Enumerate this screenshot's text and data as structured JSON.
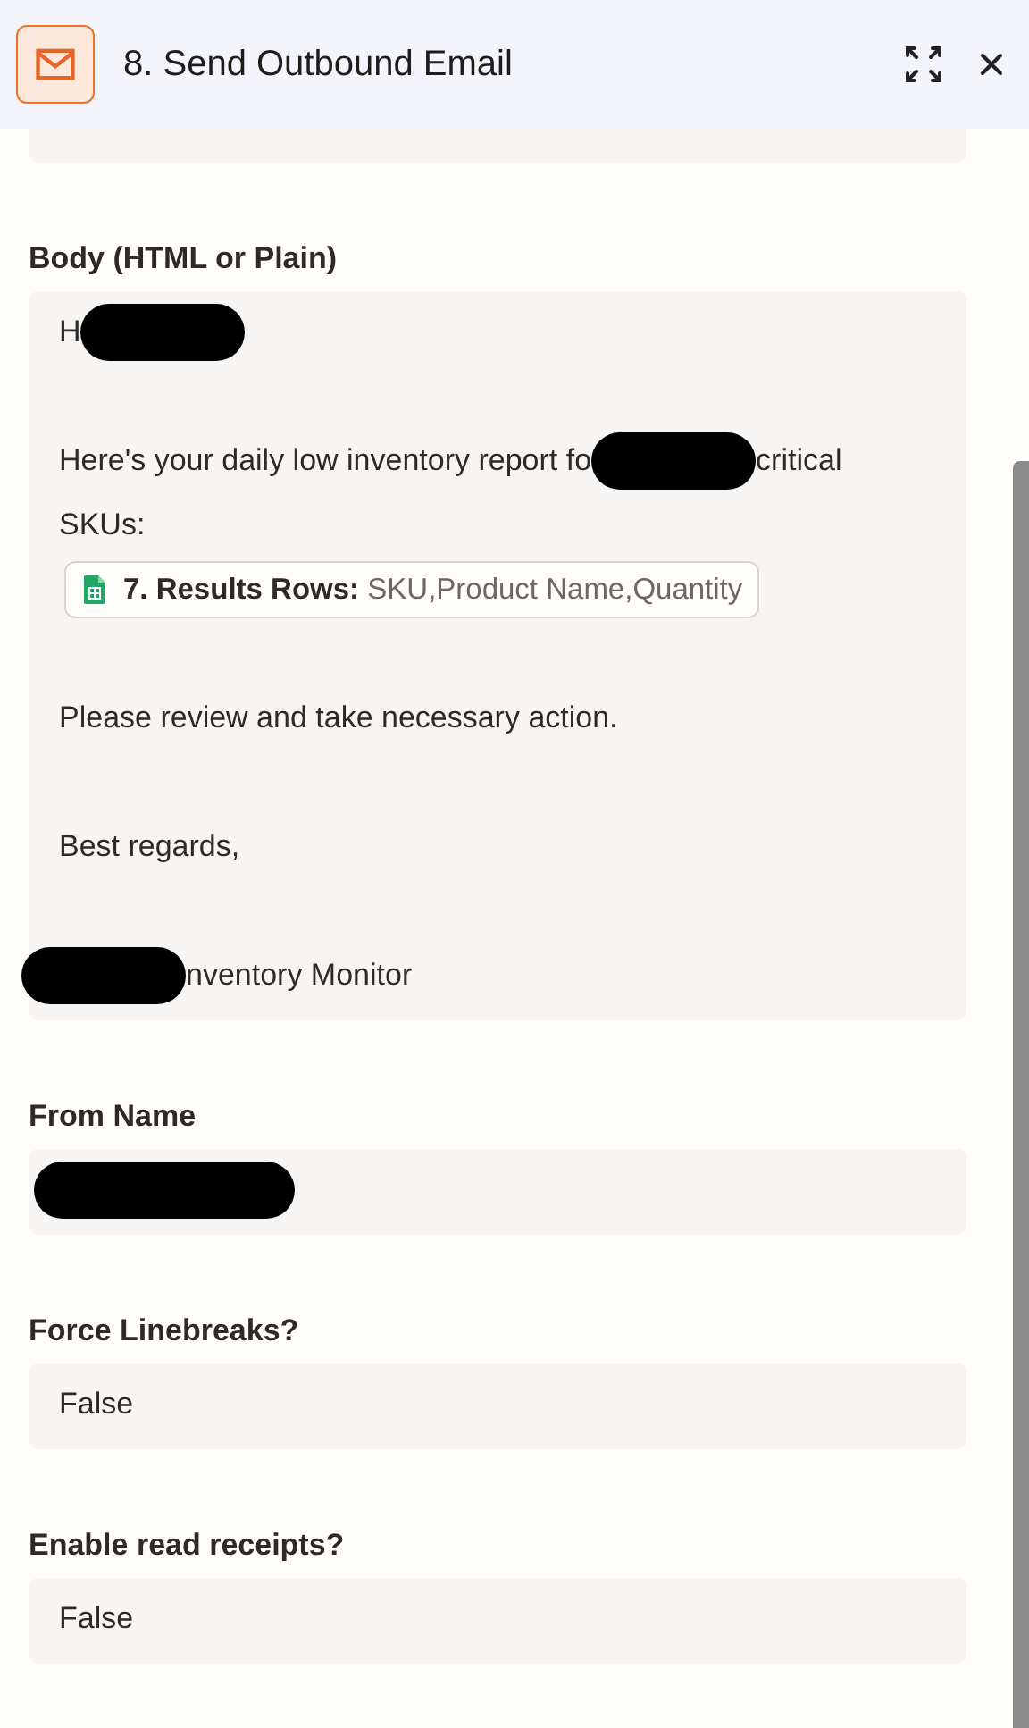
{
  "header": {
    "title": "8. Send Outbound Email"
  },
  "fields": [
    {
      "label": "Body (HTML or Plain)",
      "paragraphs": [
        [
          [
            {
              "kind": "text",
              "text": "H"
            },
            {
              "kind": "redaction"
            }
          ]
        ],
        [
          [
            {
              "kind": "text",
              "text": "Here's your daily low inventory report fo"
            },
            {
              "kind": "redaction"
            },
            {
              "kind": "text",
              "text": "critical"
            }
          ],
          [
            {
              "kind": "text",
              "text": "SKUs:"
            }
          ],
          [
            {
              "kind": "chip",
              "step": "7. Results Rows:",
              "value": "SKU,Product Name,Quantity"
            }
          ]
        ],
        [
          [
            {
              "kind": "text",
              "text": "Please review and take necessary action."
            }
          ]
        ],
        [
          [
            {
              "kind": "text",
              "text": "Best regards,"
            }
          ]
        ],
        [
          [
            {
              "kind": "redaction"
            },
            {
              "kind": "text",
              "text": "nventory Monitor"
            }
          ]
        ]
      ]
    },
    {
      "label": "From Name",
      "paragraphs": [
        [
          [
            {
              "kind": "redaction"
            }
          ]
        ]
      ]
    },
    {
      "label": "Force Linebreaks?",
      "paragraphs": [
        [
          [
            {
              "kind": "text",
              "text": "False"
            }
          ]
        ]
      ]
    },
    {
      "label": "Enable read receipts?",
      "paragraphs": [
        [
          [
            {
              "kind": "text",
              "text": "False"
            }
          ]
        ]
      ]
    }
  ]
}
